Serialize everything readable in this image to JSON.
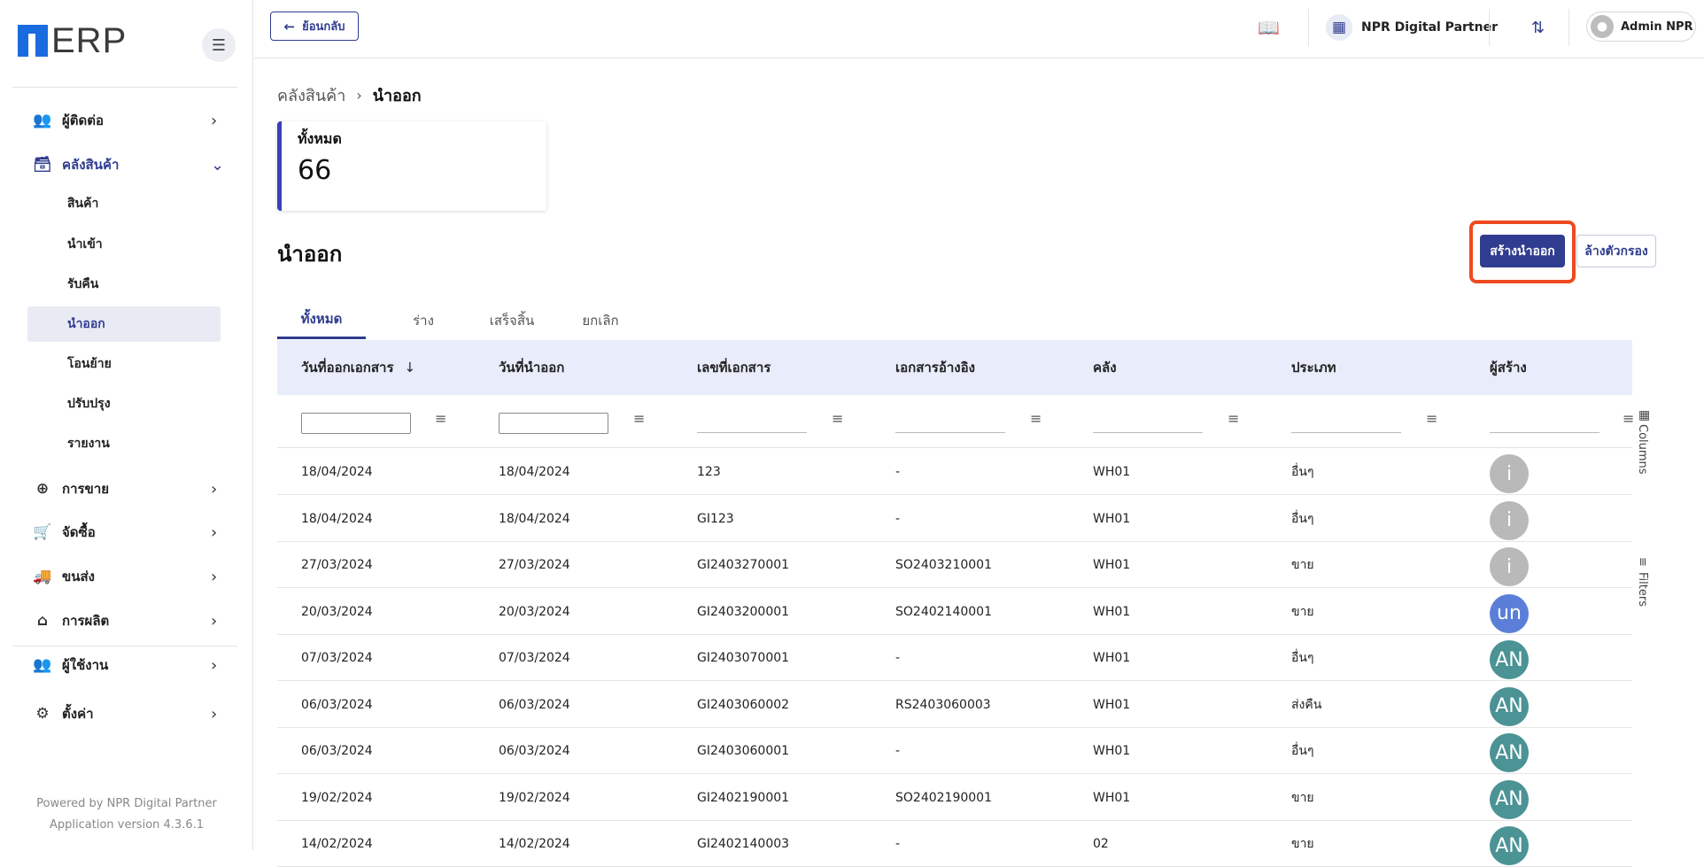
{
  "brand": {
    "logo_text": "ERP"
  },
  "sidebar": {
    "items": [
      {
        "label": "ผู้ติดต่อ",
        "icon": "contacts-icon"
      },
      {
        "label": "คลังสินค้า",
        "icon": "warehouse-icon",
        "open": true,
        "children": [
          "สินค้า",
          "นำเข้า",
          "รับคืน",
          "นำออก",
          "โอนย้าย",
          "ปรับปรุง",
          "รายงาน"
        ],
        "active_child": "นำออก"
      },
      {
        "label": "การขาย",
        "icon": "plus-circle-icon"
      },
      {
        "label": "จัดซื้อ",
        "icon": "cart-icon"
      },
      {
        "label": "ขนส่ง",
        "icon": "truck-icon"
      },
      {
        "label": "การผลิต",
        "icon": "factory-icon"
      },
      {
        "label": "ผู้ใช้งาน",
        "icon": "users-icon"
      },
      {
        "label": "ตั้งค่า",
        "icon": "settings-icon"
      }
    ],
    "footer_line1": "Powered by NPR Digital Partner",
    "footer_line2": "Application version 4.3.6.1"
  },
  "topbar": {
    "back_label": "ย้อนกลับ",
    "company": "NPR Digital Partner",
    "user": "Admin NPR"
  },
  "breadcrumb": {
    "parent": "คลังสินค้า",
    "current": "นำออก"
  },
  "summary": {
    "title": "ทั้งหมด",
    "value": "66"
  },
  "page": {
    "title": "นำออก",
    "create_label": "สร้างนำออก",
    "clear_label": "ล้างตัวกรอง"
  },
  "tabs": [
    "ทั้งหมด",
    "ร่าง",
    "เสร็จสิ้น",
    "ยกเลิก"
  ],
  "table": {
    "columns": [
      "วันที่ออกเอกสาร",
      "วันที่นำออก",
      "เลขที่เอกสาร",
      "เอกสารอ้างอิง",
      "คลัง",
      "ประเภท",
      "ผู้สร้าง"
    ],
    "rows": [
      {
        "doc_date": "18/04/2024",
        "out_date": "18/04/2024",
        "doc_no": "123",
        "ref": "-",
        "wh": "WH01",
        "type": "อื่นๆ",
        "creator": "i",
        "creator_color": "#b9b9b9"
      },
      {
        "doc_date": "18/04/2024",
        "out_date": "18/04/2024",
        "doc_no": "GI123",
        "ref": "-",
        "wh": "WH01",
        "type": "อื่นๆ",
        "creator": "i",
        "creator_color": "#b9b9b9"
      },
      {
        "doc_date": "27/03/2024",
        "out_date": "27/03/2024",
        "doc_no": "GI2403270001",
        "ref": "SO2403210001",
        "wh": "WH01",
        "type": "ขาย",
        "creator": "i",
        "creator_color": "#b9b9b9"
      },
      {
        "doc_date": "20/03/2024",
        "out_date": "20/03/2024",
        "doc_no": "GI2403200001",
        "ref": "SO2402140001",
        "wh": "WH01",
        "type": "ขาย",
        "creator": "un",
        "creator_color": "#5b7fd9"
      },
      {
        "doc_date": "07/03/2024",
        "out_date": "07/03/2024",
        "doc_no": "GI2403070001",
        "ref": "-",
        "wh": "WH01",
        "type": "อื่นๆ",
        "creator": "AN",
        "creator_color": "#4b9395"
      },
      {
        "doc_date": "06/03/2024",
        "out_date": "06/03/2024",
        "doc_no": "GI2403060002",
        "ref": "RS2403060003",
        "wh": "WH01",
        "type": "ส่งคืน",
        "creator": "AN",
        "creator_color": "#4b9395"
      },
      {
        "doc_date": "06/03/2024",
        "out_date": "06/03/2024",
        "doc_no": "GI2403060001",
        "ref": "-",
        "wh": "WH01",
        "type": "อื่นๆ",
        "creator": "AN",
        "creator_color": "#4b9395"
      },
      {
        "doc_date": "19/02/2024",
        "out_date": "19/02/2024",
        "doc_no": "GI2402190001",
        "ref": "SO2402190001",
        "wh": "WH01",
        "type": "ขาย",
        "creator": "AN",
        "creator_color": "#4b9395"
      },
      {
        "doc_date": "14/02/2024",
        "out_date": "14/02/2024",
        "doc_no": "GI2402140003",
        "ref": "-",
        "wh": "02",
        "type": "ขาย",
        "creator": "AN",
        "creator_color": "#4b9395"
      }
    ]
  },
  "side_tools": {
    "columns": "Columns",
    "filters": "Filters"
  },
  "colors": {
    "primary": "#2f3c8f",
    "highlight": "#ee4a1f",
    "header_bg": "#e8ecfb",
    "brand_blue": "#1a6be0"
  }
}
